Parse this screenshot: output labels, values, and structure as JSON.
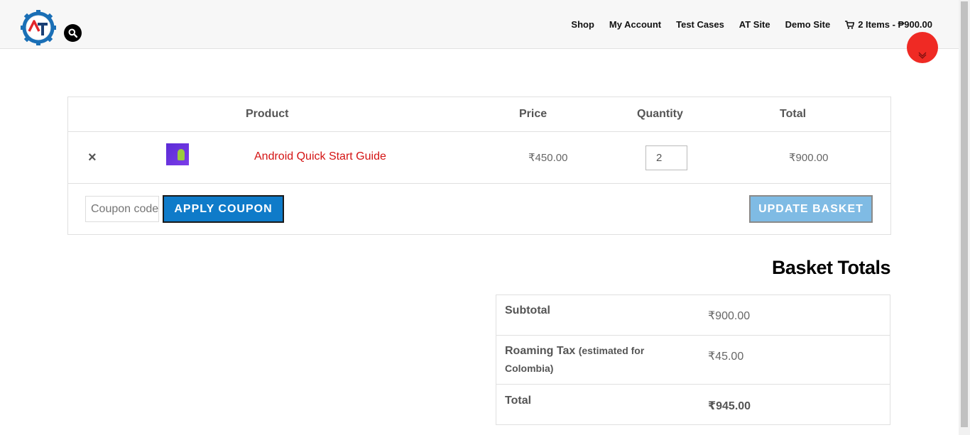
{
  "header": {
    "nav": [
      {
        "label": "Shop"
      },
      {
        "label": "My Account"
      },
      {
        "label": "Test Cases"
      },
      {
        "label": "AT Site"
      },
      {
        "label": "Demo Site"
      }
    ],
    "cart_summary": "2 Items - ₱900.00"
  },
  "cart": {
    "columns": {
      "product": "Product",
      "price": "Price",
      "quantity": "Quantity",
      "total": "Total"
    },
    "items": [
      {
        "remove": "×",
        "name": "Android Quick Start Guide",
        "price": "₹450.00",
        "quantity": "2",
        "total": "₹900.00"
      }
    ],
    "coupon_placeholder": "Coupon code",
    "apply_label": "APPLY COUPON",
    "update_label": "UPDATE BASKET"
  },
  "totals": {
    "title": "Basket Totals",
    "subtotal_label": "Subtotal",
    "subtotal_value": "₹900.00",
    "tax_label": "Roaming Tax",
    "tax_note": "(estimated for Colombia)",
    "tax_value": "₹45.00",
    "total_label": "Total",
    "total_value": "₹945.00"
  },
  "colors": {
    "accent": "#0f7bc9",
    "link": "#d41313",
    "scroll_button": "#ef2a24"
  }
}
